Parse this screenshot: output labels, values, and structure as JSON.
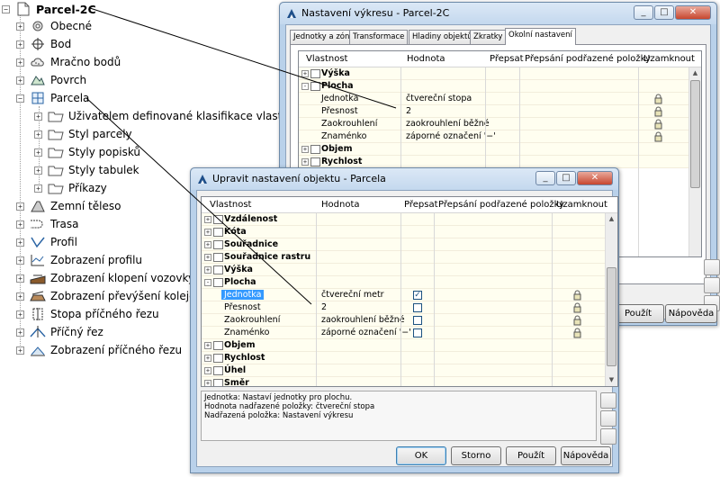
{
  "tree": {
    "root": "Parcel-2C",
    "items": [
      {
        "label": "Obecné",
        "icon": "general-icon"
      },
      {
        "label": "Bod",
        "icon": "point-icon"
      },
      {
        "label": "Mračno bodů",
        "icon": "point-cloud-icon"
      },
      {
        "label": "Povrch",
        "icon": "surface-icon"
      },
      {
        "label": "Parcela",
        "icon": "parcel-icon"
      },
      {
        "label": "Uživatelem definované klasifikace vlastností",
        "icon": "folder-icon"
      },
      {
        "label": "Styl parcely",
        "icon": "folder-icon"
      },
      {
        "label": "Styly popisků",
        "icon": "folder-icon"
      },
      {
        "label": "Styly tabulek",
        "icon": "folder-icon"
      },
      {
        "label": "Příkazy",
        "icon": "folder-icon"
      },
      {
        "label": "Zemní těleso",
        "icon": "grading-icon"
      },
      {
        "label": "Trasa",
        "icon": "alignment-icon"
      },
      {
        "label": "Profil",
        "icon": "profile-icon"
      },
      {
        "label": "Zobrazení profilu",
        "icon": "profile-view-icon"
      },
      {
        "label": "Zobrazení klopení vozovky",
        "icon": "superelevation-view-icon"
      },
      {
        "label": "Zobrazení převýšení koleje",
        "icon": "cant-view-icon"
      },
      {
        "label": "Stopa příčného řezu",
        "icon": "sample-line-icon"
      },
      {
        "label": "Příčný řez",
        "icon": "section-icon"
      },
      {
        "label": "Zobrazení příčného řezu",
        "icon": "section-view-icon"
      }
    ]
  },
  "back_window": {
    "title": "Nastavení výkresu - Parcel-2C",
    "tabs": [
      "Jednotky a zóny",
      "Transformace",
      "Hladiny objektů",
      "Zkratky",
      "Okolní nastavení"
    ],
    "active_tab": 4,
    "headers": [
      "Vlastnost",
      "Hodnota",
      "Přepsat",
      "Přepsání podřazené položky",
      "Uzamknout"
    ],
    "rows": [
      {
        "type": "group",
        "exp": "+",
        "name": "Výška"
      },
      {
        "type": "group",
        "exp": "-",
        "name": "Plocha"
      },
      {
        "type": "prop",
        "name": "Jednotka",
        "value": "čtvereční stopa",
        "lock": true
      },
      {
        "type": "prop",
        "name": "Přesnost",
        "value": "2",
        "lock": true
      },
      {
        "type": "prop",
        "name": "Zaokrouhlení",
        "value": "zaokrouhlení běžné",
        "lock": true
      },
      {
        "type": "prop",
        "name": "Znaménko",
        "value": "záporné označení '−'",
        "lock": true
      },
      {
        "type": "group",
        "exp": "+",
        "name": "Objem"
      },
      {
        "type": "group",
        "exp": "+",
        "name": "Rychlost"
      }
    ],
    "buttons": {
      "apply": "Použít",
      "help": "Nápověda"
    }
  },
  "front_window": {
    "title": "Upravit nastavení objektu - Parcela",
    "headers": [
      "Vlastnost",
      "Hodnota",
      "Přepsat",
      "Přepsání podřazené položky",
      "Uzamknout"
    ],
    "rows": [
      {
        "type": "group",
        "exp": "+",
        "name": "Vzdálenost"
      },
      {
        "type": "group",
        "exp": "+",
        "name": "Kóta"
      },
      {
        "type": "group",
        "exp": "+",
        "name": "Souřadnice"
      },
      {
        "type": "group",
        "exp": "+",
        "name": "Souřadnice rastru"
      },
      {
        "type": "group",
        "exp": "+",
        "name": "Výška"
      },
      {
        "type": "group",
        "exp": "-",
        "name": "Plocha"
      },
      {
        "type": "prop",
        "name": "Jednotka",
        "value": "čtvereční metr",
        "override": true,
        "lock": true,
        "selected": true
      },
      {
        "type": "prop",
        "name": "Přesnost",
        "value": "2",
        "override": false,
        "lock": true
      },
      {
        "type": "prop",
        "name": "Zaokrouhlení",
        "value": "zaokrouhlení běžné",
        "override": false,
        "lock": true
      },
      {
        "type": "prop",
        "name": "Znaménko",
        "value": "záporné označení '−'",
        "override": false,
        "lock": true
      },
      {
        "type": "group",
        "exp": "+",
        "name": "Objem"
      },
      {
        "type": "group",
        "exp": "+",
        "name": "Rychlost"
      },
      {
        "type": "group",
        "exp": "+",
        "name": "Úhel"
      },
      {
        "type": "group",
        "exp": "+",
        "name": "Směr"
      }
    ],
    "description": [
      "Jednotka: Nastaví jednotky pro plochu.",
      "Hodnota nadřazené položky: čtvereční stopa",
      "Nadřazená položka: Nastavení výkresu"
    ],
    "buttons": {
      "ok": "OK",
      "cancel": "Storno",
      "apply": "Použít",
      "help": "Nápověda"
    }
  }
}
